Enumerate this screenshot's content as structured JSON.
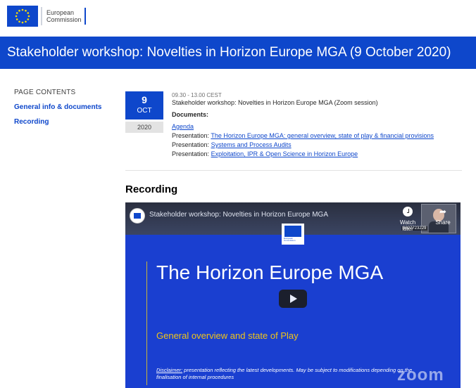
{
  "header": {
    "logo_text_line1": "European",
    "logo_text_line2": "Commission",
    "page_title": "Stakeholder workshop: Novelties in Horizon Europe MGA (9 October 2020)"
  },
  "sidebar": {
    "heading": "PAGE CONTENTS",
    "links": [
      {
        "label": "General info & documents"
      },
      {
        "label": "Recording"
      }
    ]
  },
  "event": {
    "day": "9",
    "month": "OCT",
    "year": "2020",
    "time": "09.30 - 13.00 CEST",
    "title": "Stakeholder workshop: Novelties in Horizon Europe MGA (Zoom session)",
    "documents_label": "Documents:",
    "agenda_link": "Agenda",
    "presentations": [
      {
        "prefix": "Presentation:",
        "link": "The Horizon Europe MGA: general overview, state of play & financial provisions"
      },
      {
        "prefix": "Presentation:",
        "link": "Systems and Process Audits"
      },
      {
        "prefix": "Presentation:",
        "link": "Exploitation, IPR & Open Science in Horizon Europe"
      }
    ]
  },
  "recording": {
    "heading": "Recording",
    "video": {
      "title": "Stakeholder workshop: Novelties in Horizon Europe MGA",
      "watch_later_label": "Watch later",
      "share_label": "Share",
      "speaker_number": "8627723229",
      "slide_logo_text": "European Commission",
      "slide_title": "The Horizon Europe MGA",
      "slide_subtitle": "General overview and state of Play",
      "disclaimer_label": "Disclaimer:",
      "disclaimer_text": " presentation reflecting the latest developments. May be subject to modifications depending on the finalisation of internal procedures",
      "watermark": "zoom"
    }
  },
  "colors": {
    "brand_blue": "#0e47cb",
    "slide_yellow": "#f0c419"
  }
}
